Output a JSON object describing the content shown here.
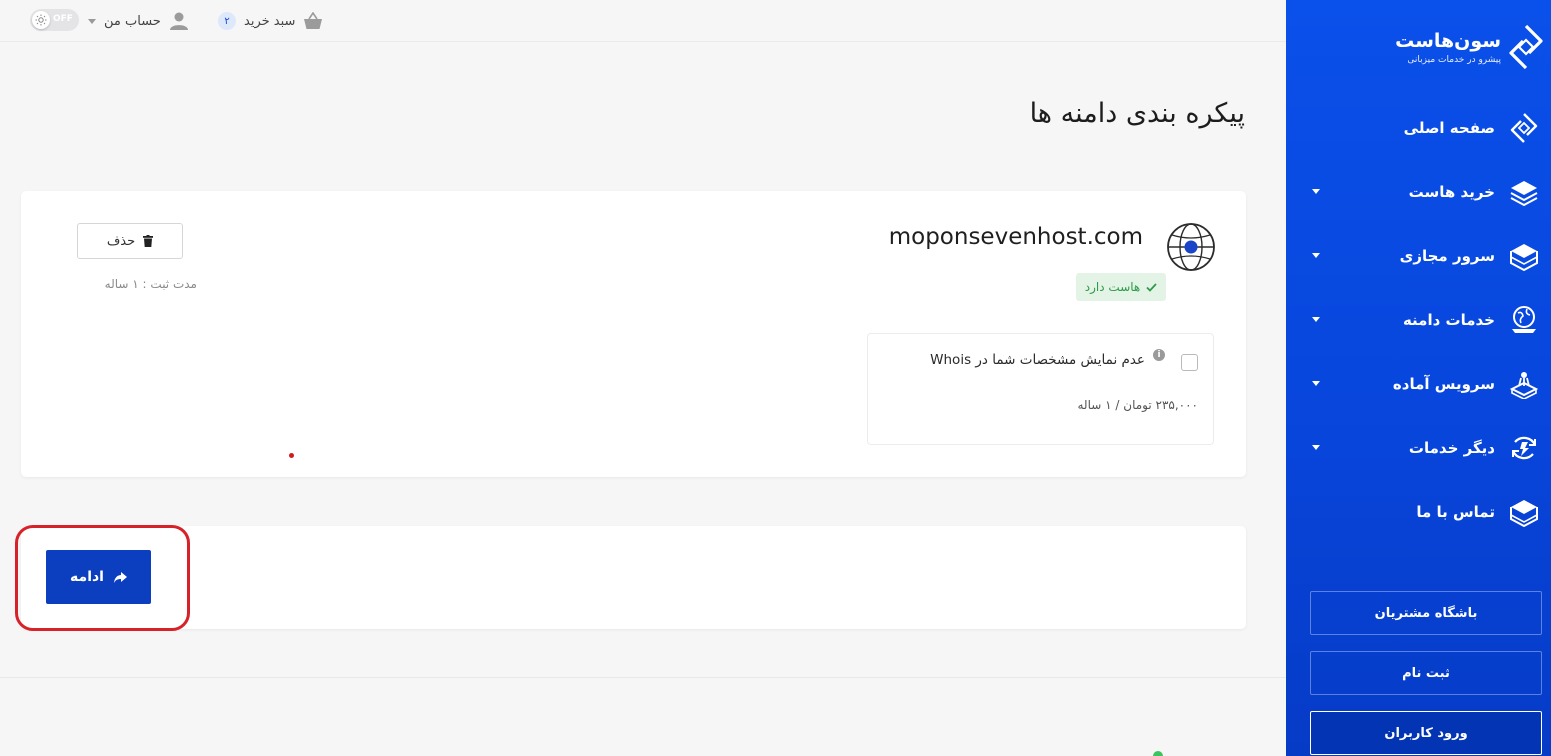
{
  "topbar": {
    "toggle_label": "OFF",
    "account_label": "حساب من",
    "account_icon": "user-icon",
    "cart_label": "سبد خرید",
    "cart_count": "۲",
    "cart_icon": "basket-icon"
  },
  "page": {
    "title": "پیکره بندی دامنه ها"
  },
  "domain": {
    "name": "moponsevenhost.com",
    "host_badge": "هاست دارد",
    "delete_label": "حذف",
    "registration_period": "مدت ثبت : ۱ ساله",
    "whois_label": "عدم نمایش مشخصات شما در Whois",
    "whois_checked": false,
    "whois_price": "۲۳۵,۰۰۰ تومان / ۱ ساله"
  },
  "actions": {
    "continue_label": "ادامه"
  },
  "sidebar": {
    "brand_name": "سون‌هاست",
    "brand_tagline": "پیشرو در خدمات میزبانی",
    "items": [
      {
        "label": "صفحه اصلی",
        "icon": "logo-icon",
        "has_submenu": false
      },
      {
        "label": "خرید هاست",
        "icon": "layers-icon",
        "has_submenu": true
      },
      {
        "label": "سرور مجازی",
        "icon": "server-box-icon",
        "has_submenu": true
      },
      {
        "label": "خدمات دامنه",
        "icon": "globe-icon",
        "has_submenu": true
      },
      {
        "label": "سرویس آماده",
        "icon": "package-icon",
        "has_submenu": true
      },
      {
        "label": "دیگر خدمات",
        "icon": "settings-cycle-icon",
        "has_submenu": true
      },
      {
        "label": "تماس با ما",
        "icon": "envelope-icon",
        "has_submenu": false
      }
    ],
    "club_label": "باشگاه مشتریان",
    "register_label": "ثبت نام",
    "login_label": "ورود کاربران"
  },
  "colors": {
    "sidebar_blue": "#0846dc",
    "button_blue": "#0c3fbf",
    "highlight_red": "#d62229",
    "success_green": "#2e9a4a"
  }
}
